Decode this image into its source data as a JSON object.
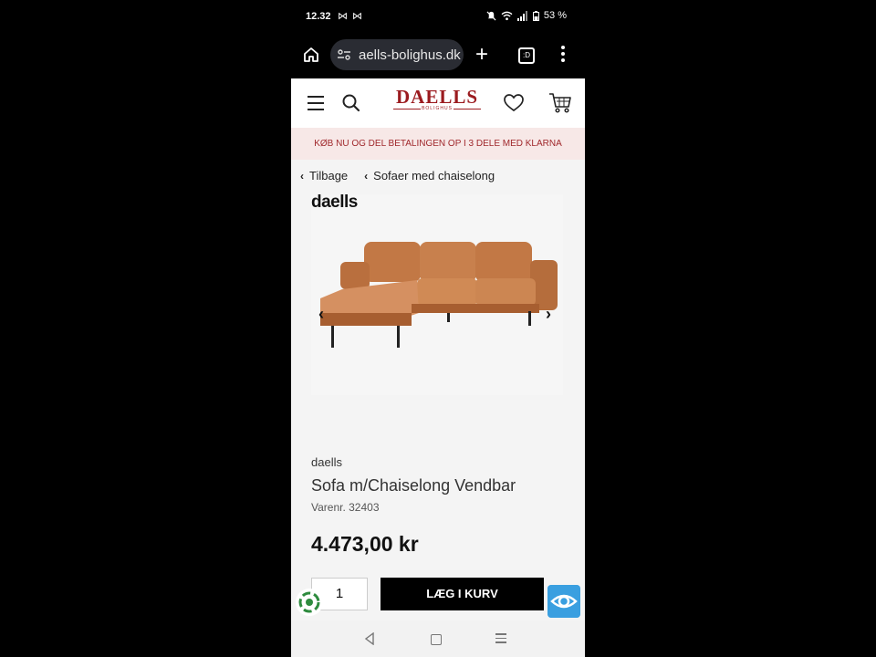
{
  "status": {
    "time": "12.32",
    "notif": "⋈ ⋈",
    "battery": "53 %"
  },
  "browser": {
    "url": "aells-bolighus.dk",
    "tabs_count": ":D"
  },
  "header": {
    "logo_brand": "DAELLS",
    "logo_sub": "BOLIGHUS"
  },
  "banner": {
    "text": "KØB NU OG DEL BETALINGEN OP I 3 DELE MED KLARNA"
  },
  "breadcrumbs": {
    "back": "Tilbage",
    "category": "Sofaer med chaiselong"
  },
  "product": {
    "image_logo": "daells",
    "brand": "daells",
    "title": "Sofa m/Chaiselong Vendbar",
    "sku": "Varenr. 32403",
    "price": "4.473,00 kr",
    "quantity": "1",
    "add_to_cart": "LÆG I KURV"
  },
  "colors": {
    "accent": "#9b1b1f",
    "banner_bg": "#f7e8e7",
    "sofa": "#c27845"
  }
}
